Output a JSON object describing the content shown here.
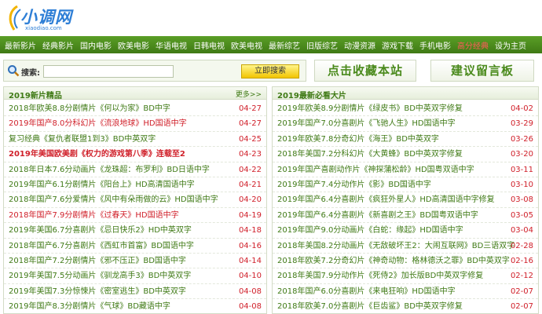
{
  "logo": {
    "title": "小调网",
    "domain": "xiaodiao.com"
  },
  "nav": [
    {
      "label": "最新影片"
    },
    {
      "label": "经典影片"
    },
    {
      "label": "国内电影"
    },
    {
      "label": "欧美电影"
    },
    {
      "label": "华语电视"
    },
    {
      "label": "日韩电视"
    },
    {
      "label": "欧美电视"
    },
    {
      "label": "最新综艺"
    },
    {
      "label": "旧版综艺"
    },
    {
      "label": "动漫资源"
    },
    {
      "label": "游戏下载"
    },
    {
      "label": "手机电影"
    },
    {
      "label": "高分经典",
      "hot": true
    },
    {
      "label": "设为主页"
    }
  ],
  "search": {
    "label": "搜索:",
    "value": "",
    "button": "立即搜索"
  },
  "buttons": {
    "favorite": "点击收藏本站",
    "guestbook": "建议留言板"
  },
  "left_panel": {
    "title": "2019新片精品",
    "more": "更多>>",
    "items": [
      {
        "title": "2018年欧美8.8分剧情片《何以为家》BD中字",
        "date": "04-27",
        "style": "green"
      },
      {
        "title": "2019年国产8.0分科幻片《流浪地球》HD国语中字",
        "date": "04-27",
        "style": "red"
      },
      {
        "title": "复习经典《复仇者联盟1到3》BD中英双字",
        "date": "04-25",
        "style": "green"
      },
      {
        "title": "2019年美国欧美剧《权力的游戏第八季》连载至2",
        "date": "04-23",
        "style": "redbold"
      },
      {
        "title": "2018年日本7.6分动画片《龙珠超：布罗利》BD日语中字",
        "date": "04-22",
        "style": "green"
      },
      {
        "title": "2019年国产6.1分剧情片《阳台上》HD高清国语中字",
        "date": "04-21",
        "style": "green"
      },
      {
        "title": "2018年国产7.6分爱情片《风中有朵雨做的云》HD国语中字",
        "date": "04-20",
        "style": "green"
      },
      {
        "title": "2018年国产7.9分剧情片《过春天》HD国语中字",
        "date": "04-19",
        "style": "red"
      },
      {
        "title": "2019年美国6.7分喜剧片《忌日快乐2》HD中英双字",
        "date": "04-18",
        "style": "green"
      },
      {
        "title": "2018年国产6.7分喜剧片《西虹市首富》BD国语中字",
        "date": "04-16",
        "style": "green"
      },
      {
        "title": "2018年国产7.2分剧情片《邪不压正》BD国语中字",
        "date": "04-14",
        "style": "green"
      },
      {
        "title": "2019年美国7.5分动画片《驯龙高手3》BD中英双字",
        "date": "04-10",
        "style": "green"
      },
      {
        "title": "2019年美国7.3分惊悚片《密室逃生》BD中英双字",
        "date": "04-08",
        "style": "green"
      },
      {
        "title": "2019年国产8.3分剧情片《气球》BD藏语中字",
        "date": "04-08",
        "style": "green"
      },
      {
        "title": "2018年韩国7.2分动作片《魔女》BD韩语中字",
        "date": "04-05",
        "style": "green"
      }
    ]
  },
  "right_panel": {
    "title": "2019最新必看大片",
    "items": [
      {
        "title": "2019年欧美8.9分剧情片《绿皮书》BD中英双字修复",
        "date": "04-02",
        "style": "green"
      },
      {
        "title": "2019年国产7.0分喜剧片《飞驰人生》HD国语中字",
        "date": "03-29",
        "style": "green"
      },
      {
        "title": "2019年欧美7.8分奇幻片《海王》BD中英双字",
        "date": "03-26",
        "style": "green"
      },
      {
        "title": "2018年美国7.2分科幻片《大黄蜂》BD中英双字修复",
        "date": "03-20",
        "style": "green"
      },
      {
        "title": "2019年国产喜剧动作片《神探蒲松龄》HD国粤双语中字",
        "date": "03-11",
        "style": "green"
      },
      {
        "title": "2019年国产7.4分动作片《影》BD国语中字",
        "date": "03-10",
        "style": "green"
      },
      {
        "title": "2019年国产6.4分喜剧片《疯狂外星人》HD高清国语中字修复",
        "date": "03-08",
        "style": "green"
      },
      {
        "title": "2019年国产6.4分喜剧片《新喜剧之王》BD国粤双语中字",
        "date": "03-05",
        "style": "green"
      },
      {
        "title": "2019年国产9.0分动画片《白蛇：缘起》HD国语中字",
        "date": "03-04",
        "style": "green"
      },
      {
        "title": "2018年美国8.2分动画片《无敌破坏王2：大闹互联网》BD三语双字",
        "date": "02-28",
        "style": "green"
      },
      {
        "title": "2018年欧美7.2分奇幻片《神奇动物：格林德沃之罪》BD中英双字",
        "date": "02-16",
        "style": "green"
      },
      {
        "title": "2018年美国7.9分动作片《死侍2》加长版BD中英双字修复",
        "date": "02-12",
        "style": "green"
      },
      {
        "title": "2018年国产6.0分喜剧片《来电狂响》HD国语中字",
        "date": "02-07",
        "style": "green"
      },
      {
        "title": "2018年欧美7.0分喜剧片《巨齿鲨》BD中英双字修复",
        "date": "02-07",
        "style": "green"
      },
      {
        "title": "2018年欧美6.7分动作片《冰海陷落》BD中英双字修正",
        "date": "02-06",
        "style": "green"
      }
    ]
  }
}
